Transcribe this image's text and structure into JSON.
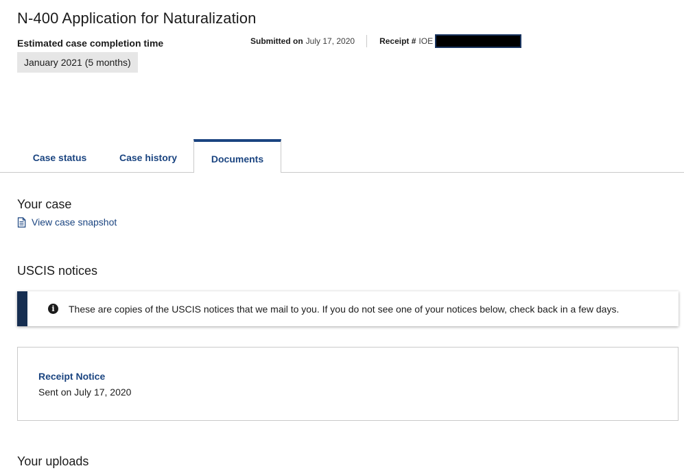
{
  "header": {
    "title": "N-400 Application for Naturalization",
    "estimated_label": "Estimated case completion time",
    "estimated_value": "January 2021 (5 months)",
    "submitted_label": "Submitted on",
    "submitted_date": "July 17, 2020",
    "receipt_label": "Receipt #",
    "receipt_prefix": "IOE"
  },
  "tabs": [
    {
      "label": "Case status",
      "active": false
    },
    {
      "label": "Case history",
      "active": false
    },
    {
      "label": "Documents",
      "active": true
    }
  ],
  "your_case": {
    "heading": "Your case",
    "snapshot_link": "View case snapshot",
    "icon": "document-icon"
  },
  "notices": {
    "heading": "USCIS notices",
    "alert_text": "These are copies of the USCIS notices that we mail to you. If you do not see one of your notices below, check back in a few days.",
    "alert_icon": "info-icon",
    "items": [
      {
        "title": "Receipt Notice",
        "sent": "Sent on July 17, 2020"
      }
    ]
  },
  "uploads": {
    "heading": "Your uploads"
  },
  "colors": {
    "link": "#1a4480",
    "alert_border": "#162e51",
    "badge_bg": "#e6e6e6"
  }
}
